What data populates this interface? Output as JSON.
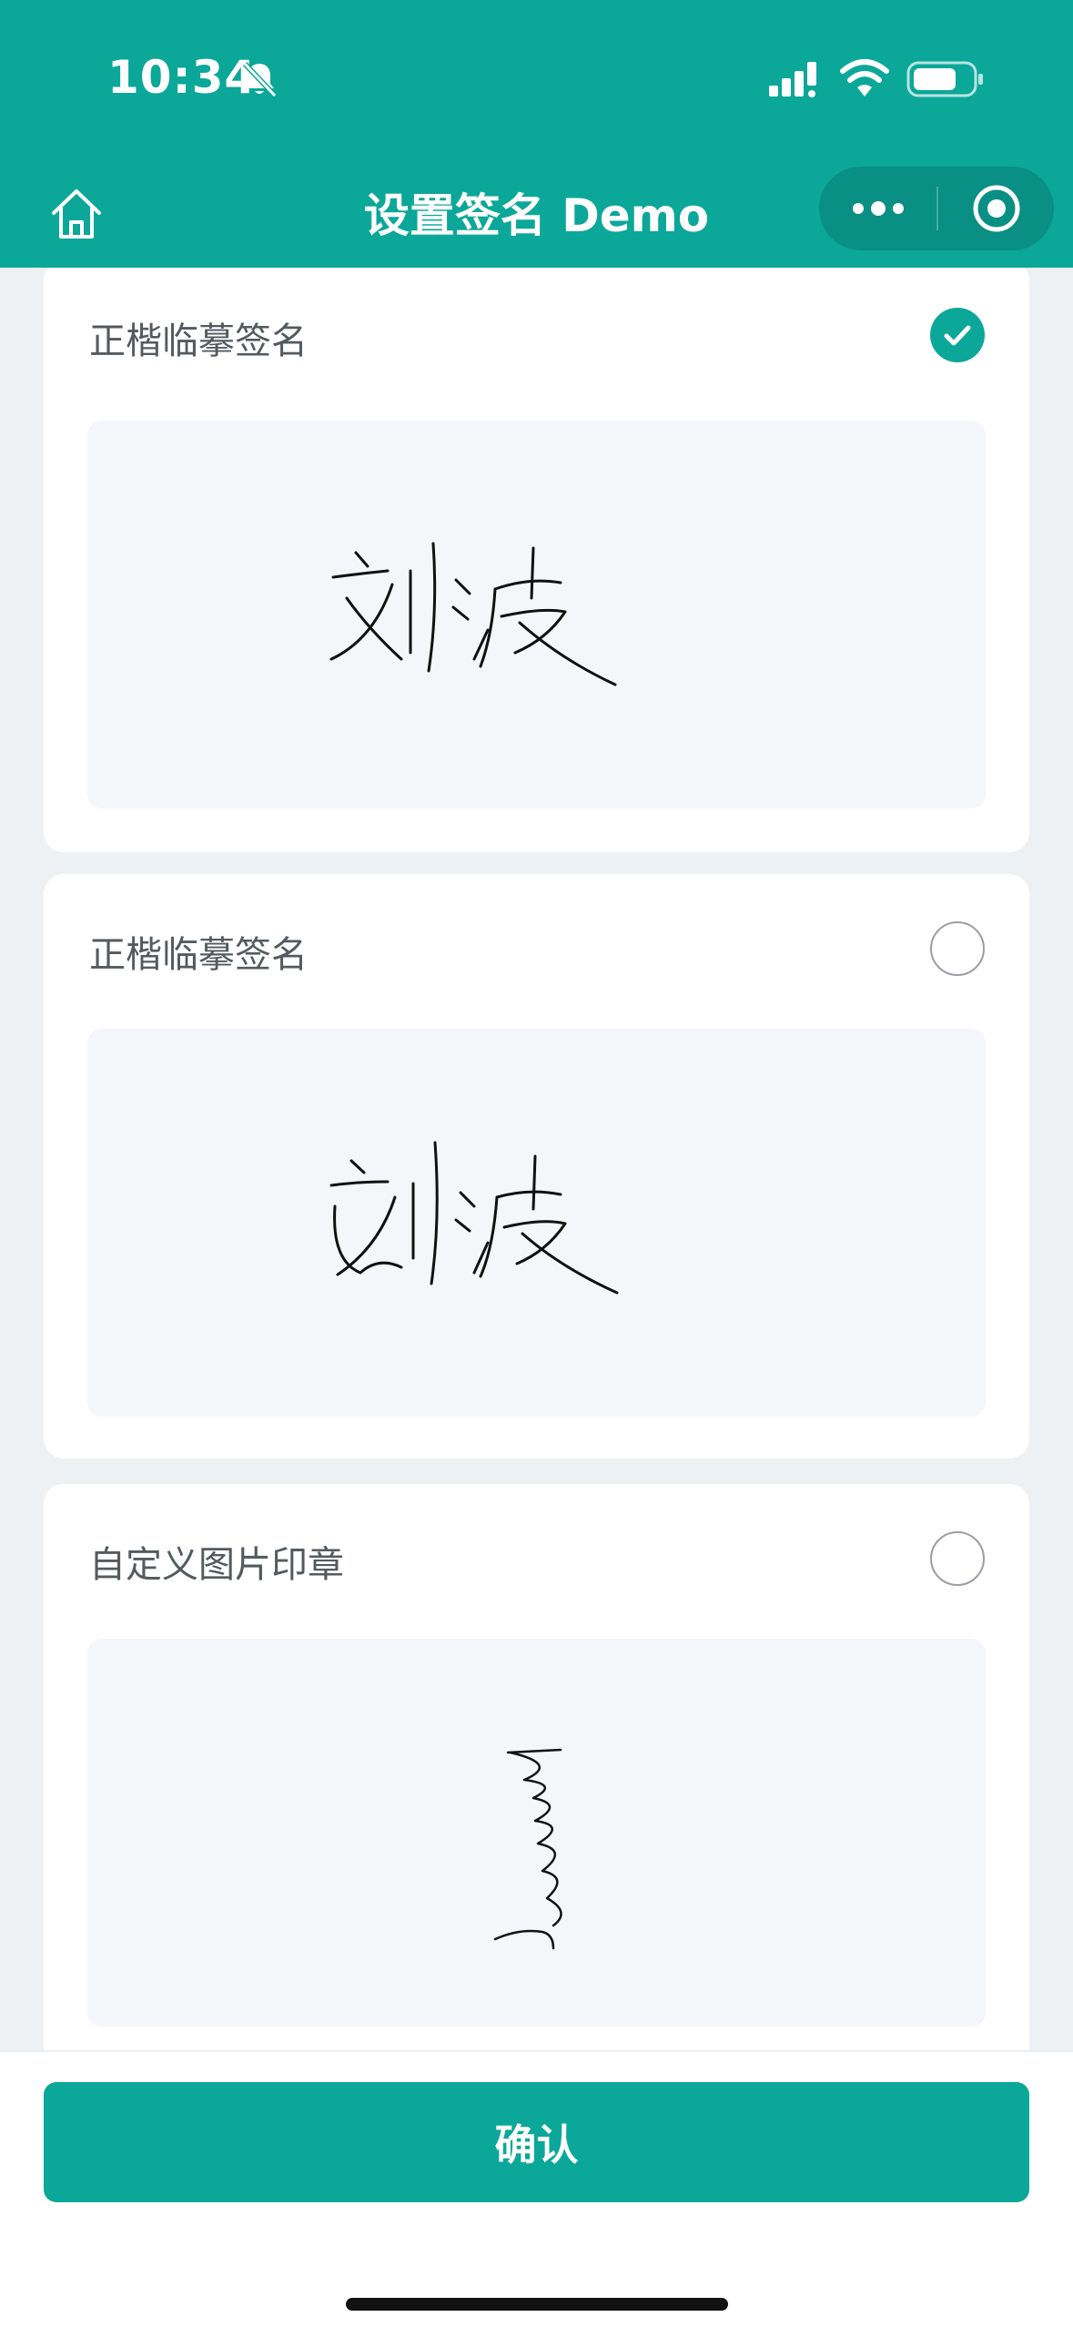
{
  "status_bar": {
    "time": "10:34",
    "icons": [
      "bell-muted-icon",
      "signal-icon",
      "wifi-icon",
      "battery-icon"
    ]
  },
  "nav": {
    "title": "设置签名 Demo",
    "icons": [
      "home-icon",
      "more-icon",
      "close-target-icon"
    ]
  },
  "options": [
    {
      "title": "正楷临摹签名",
      "selected": true
    },
    {
      "title": "正楷临摹签名",
      "selected": false
    },
    {
      "title": "自定义图片印章",
      "selected": false
    }
  ],
  "footer": {
    "confirm_label": "确认"
  },
  "colors": {
    "accent": "#0ba799",
    "background": "#eef1f4",
    "card": "#ffffff",
    "signature_bg": "#f5f6fa"
  }
}
